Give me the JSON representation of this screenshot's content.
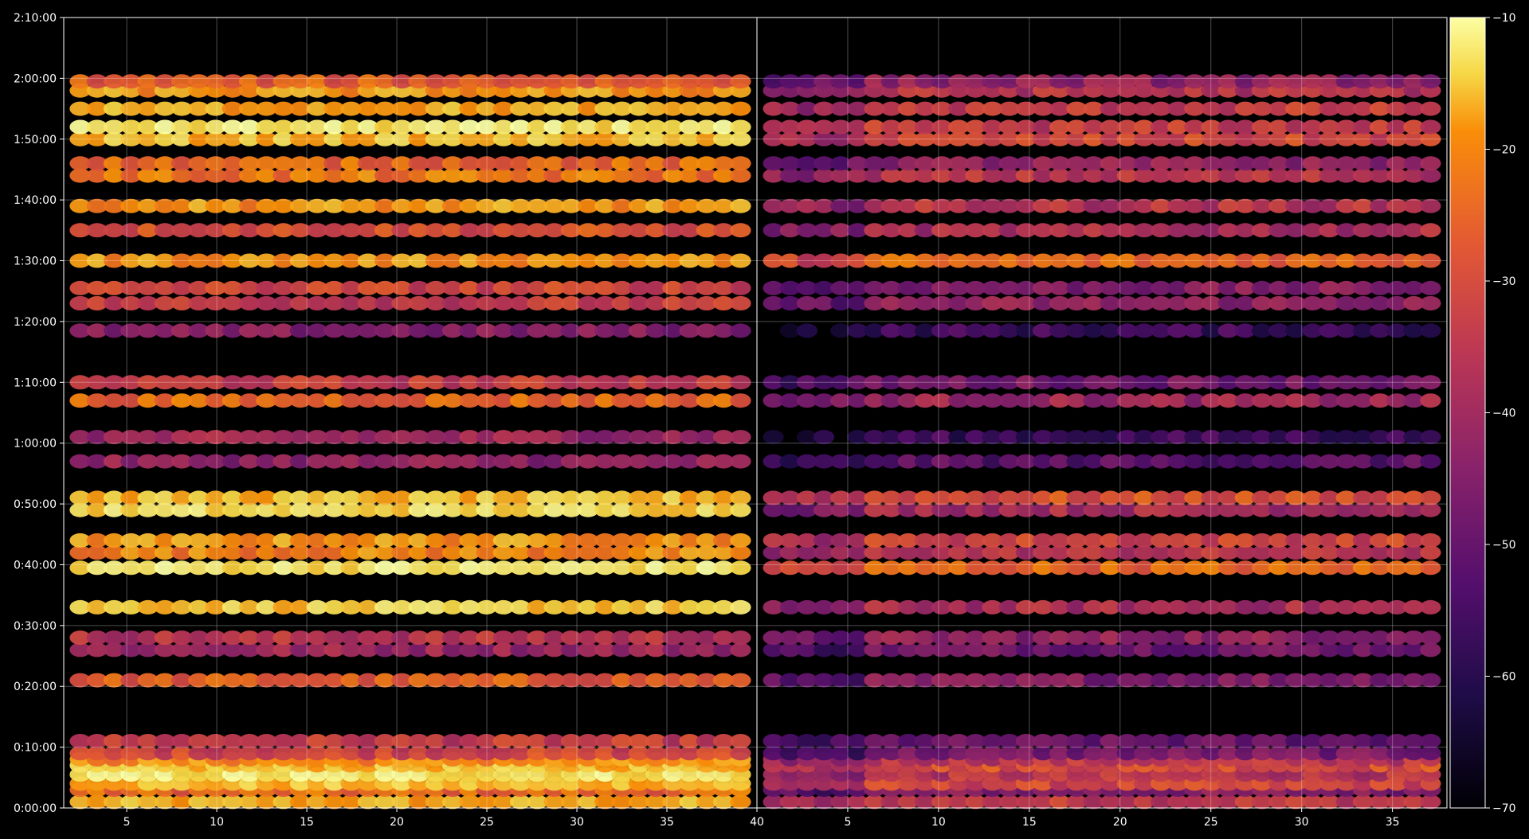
{
  "chart_data": {
    "type": "heatmap",
    "title": "",
    "xlabel": "",
    "ylabel": "",
    "grid": true,
    "colormap": "inferno",
    "background": "#000000",
    "panels": [
      {
        "x_range": [
          1.5,
          40
        ],
        "x_ticks": [
          5,
          10,
          15,
          20,
          25,
          30,
          35,
          40
        ],
        "x_tick_labels": [
          "5",
          "10",
          "15",
          "20",
          "25",
          "30",
          "35",
          "40"
        ]
      },
      {
        "x_range": [
          0,
          38
        ],
        "x_ticks": [
          5,
          10,
          15,
          20,
          25,
          30,
          35,
          40
        ],
        "x_tick_labels": [
          "5",
          "10",
          "15",
          "20",
          "25",
          "30",
          "35",
          "40"
        ]
      }
    ],
    "y_range_seconds": [
      0,
      7800
    ],
    "y_ticks_seconds": [
      0,
      600,
      1200,
      1800,
      2400,
      3000,
      3600,
      4200,
      4800,
      5400,
      6000,
      6600,
      7200,
      7800
    ],
    "y_tick_labels": [
      "0:00:00",
      "0:10:00",
      "0:20:00",
      "0:30:00",
      "0:40:00",
      "0:50:00",
      "1:00:00",
      "1:10:00",
      "1:20:00",
      "1:30:00",
      "1:40:00",
      "1:50:00",
      "2:00:00",
      "2:10:00"
    ],
    "colorbar": {
      "range": [
        -70,
        -10
      ],
      "ticks": [
        -70,
        -60,
        -50,
        -40,
        -30,
        -20,
        -10
      ],
      "tick_labels": [
        "−70",
        "−60",
        "−50",
        "−40",
        "−30",
        "−20",
        "−10"
      ]
    },
    "bands": [
      {
        "t": 60,
        "left": -22,
        "right": -38
      },
      {
        "t": 180,
        "left": -30,
        "right": -48
      },
      {
        "t": 240,
        "left": -20,
        "right": -36
      },
      {
        "t": 330,
        "left": -14,
        "right": -40
      },
      {
        "t": 420,
        "left": -20,
        "right": -34
      },
      {
        "t": 480,
        "left": -26,
        "right": -40
      },
      {
        "t": 540,
        "left": -36,
        "right": -50
      },
      {
        "t": 660,
        "left": -38,
        "right": -52
      },
      {
        "t": 1260,
        "left": -32,
        "right": -48
      },
      {
        "t": 1560,
        "left": -44,
        "right": -50
      },
      {
        "t": 1680,
        "left": -40,
        "right": -46
      },
      {
        "t": 1980,
        "left": -18,
        "right": -42
      },
      {
        "t": 2370,
        "left": -14,
        "right": -30
      },
      {
        "t": 2520,
        "left": -26,
        "right": -40
      },
      {
        "t": 2640,
        "left": -24,
        "right": -36
      },
      {
        "t": 2940,
        "left": -16,
        "right": -42
      },
      {
        "t": 3060,
        "left": -20,
        "right": -34
      },
      {
        "t": 3420,
        "left": -46,
        "right": -54
      },
      {
        "t": 3660,
        "left": -44,
        "right": -58
      },
      {
        "t": 4020,
        "left": -30,
        "right": -44
      },
      {
        "t": 4200,
        "left": -38,
        "right": -50
      },
      {
        "t": 4710,
        "left": -48,
        "right": -58
      },
      {
        "t": 4980,
        "left": -38,
        "right": -46
      },
      {
        "t": 5130,
        "left": -36,
        "right": -48
      },
      {
        "t": 5400,
        "left": -24,
        "right": -30
      },
      {
        "t": 5700,
        "left": -34,
        "right": -42
      },
      {
        "t": 5940,
        "left": -24,
        "right": -40
      },
      {
        "t": 6240,
        "left": -28,
        "right": -40
      },
      {
        "t": 6360,
        "left": -30,
        "right": -46
      },
      {
        "t": 6600,
        "left": -20,
        "right": -36
      },
      {
        "t": 6720,
        "left": -14,
        "right": -38
      },
      {
        "t": 6900,
        "left": -22,
        "right": -38
      },
      {
        "t": 7080,
        "left": -24,
        "right": -40
      },
      {
        "t": 7170,
        "left": -32,
        "right": -46
      }
    ]
  }
}
